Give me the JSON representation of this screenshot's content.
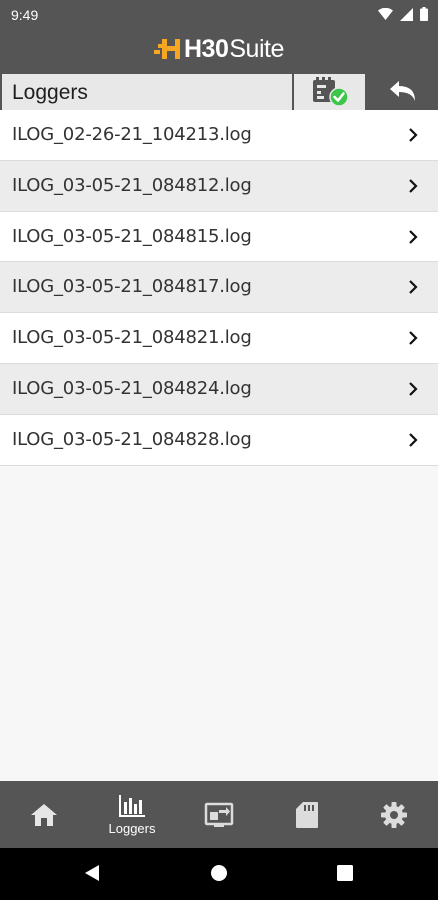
{
  "status_bar": {
    "time": "9:49"
  },
  "branding": {
    "logo_text_bold": "H30",
    "logo_text_light": "Suite",
    "accent_color": "#f5a623"
  },
  "toolbar": {
    "title": "Loggers",
    "sync_icon": "logger-sync-check-icon",
    "back_icon": "back-arrow-icon"
  },
  "files": [
    {
      "name": "ILOG_02-26-21_104213.log"
    },
    {
      "name": "ILOG_03-05-21_084812.log"
    },
    {
      "name": "ILOG_03-05-21_084815.log"
    },
    {
      "name": "ILOG_03-05-21_084817.log"
    },
    {
      "name": "ILOG_03-05-21_084821.log"
    },
    {
      "name": "ILOG_03-05-21_084824.log"
    },
    {
      "name": "ILOG_03-05-21_084828.log"
    }
  ],
  "bottom_nav": {
    "items": [
      {
        "icon": "home-icon",
        "label": ""
      },
      {
        "icon": "bar-chart-icon",
        "label": "Loggers"
      },
      {
        "icon": "device-transfer-icon",
        "label": ""
      },
      {
        "icon": "sd-card-icon",
        "label": ""
      },
      {
        "icon": "gear-icon",
        "label": ""
      }
    ]
  },
  "colors": {
    "header_bg": "#555555",
    "row_alt_bg": "#ececec",
    "success_green": "#3ec64a"
  }
}
